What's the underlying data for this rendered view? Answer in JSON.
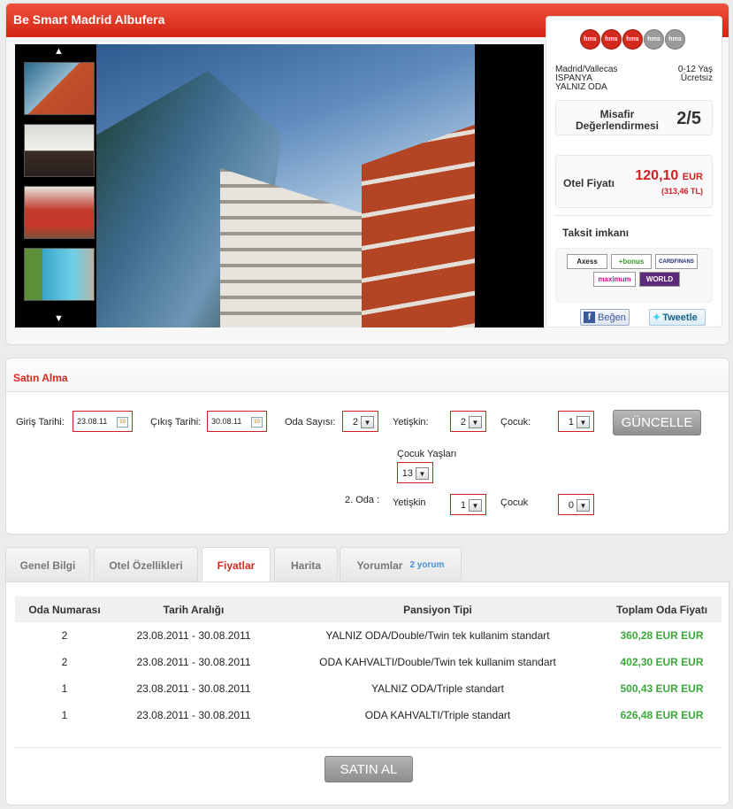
{
  "hotel": {
    "title": "Be Smart Madrid Albufera",
    "stars": {
      "filled": 3,
      "total": 5,
      "badge_label": "hms"
    },
    "location": {
      "city": "Madrid/Vallecas",
      "country": "ISPANYA",
      "board": "YALNIZ ODA"
    },
    "child_policy": {
      "age": "0-12 Yaş",
      "price": "Ücretsiz"
    },
    "rating": {
      "label": "Misafir Değerlendirmesi",
      "value": "2/5"
    },
    "price": {
      "label": "Otel Fiyatı",
      "amount": "120,10",
      "unit": "EUR",
      "try": "(313,46 TL)"
    },
    "installments": {
      "label": "Taksit imkanı",
      "cards": [
        "Axess",
        "bonus",
        "CARDFINANS",
        "maximum",
        "WORLD"
      ]
    },
    "social": {
      "like": "Beğen",
      "tweet": "Tweetle"
    },
    "gallery": {
      "thumbs": [
        "building-exterior",
        "bedroom-sofa",
        "red-bedroom",
        "pool"
      ],
      "main": "building-exterior"
    }
  },
  "purchase": {
    "title": "Satın Alma",
    "checkin_label": "Giriş Tarihi:",
    "checkin_value": "23.08.11",
    "checkout_label": "Çıkış Tarihi:",
    "checkout_value": "30.08.11",
    "rooms_label": "Oda Sayısı:",
    "rooms_value": "2",
    "adults_label": "Yetişkin:",
    "adults_value": "2",
    "children_label": "Çocuk:",
    "children_value": "1",
    "update_button": "GÜNCELLE",
    "child_ages_label": "Çocuk Yaşları",
    "child_age_value": "13",
    "room2_label": "2. Oda :",
    "room2_adults_label": "Yetişkin",
    "room2_adults_value": "1",
    "room2_children_label": "Çocuk",
    "room2_children_value": "0"
  },
  "tabs": [
    {
      "label": "Genel Bilgi"
    },
    {
      "label": "Otel Özellikleri"
    },
    {
      "label": "Fiyatlar",
      "active": true
    },
    {
      "label": "Harita"
    },
    {
      "label": "Yorumlar",
      "count": "2 yorum"
    }
  ],
  "prices": {
    "headers": [
      "Oda Numarası",
      "Tarih Aralığı",
      "Pansiyon Tipi",
      "Toplam Oda Fiyatı"
    ],
    "rows": [
      {
        "room": "2",
        "dates": "23.08.2011 - 30.08.2011",
        "board": "YALNIZ ODA/Double/Twin tek kullanim standart",
        "price": "360,28 EUR EUR"
      },
      {
        "room": "2",
        "dates": "23.08.2011 - 30.08.2011",
        "board": "ODA KAHVALTI/Double/Twin tek kullanim standart",
        "price": "402,30 EUR EUR"
      },
      {
        "room": "1",
        "dates": "23.08.2011 - 30.08.2011",
        "board": "YALNIZ ODA/Triple standart",
        "price": "500,43 EUR EUR"
      },
      {
        "room": "1",
        "dates": "23.08.2011 - 30.08.2011",
        "board": "ODA KAHVALTI/Triple standart",
        "price": "626,48 EUR EUR"
      }
    ],
    "buy_button": "SATIN AL"
  },
  "colors": {
    "brand_red": "#d32a1d",
    "price_green": "#3aa83a",
    "link_blue": "#4a90d9"
  }
}
